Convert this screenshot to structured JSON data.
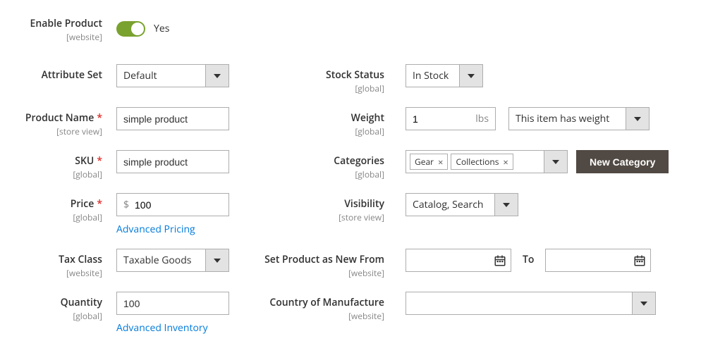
{
  "enable": {
    "label": "Enable Product",
    "scope": "[website]",
    "state_text": "Yes"
  },
  "attribute_set": {
    "label": "Attribute Set",
    "value": "Default"
  },
  "product_name": {
    "label": "Product Name",
    "scope": "[store view]",
    "value": "simple product"
  },
  "sku": {
    "label": "SKU",
    "scope": "[global]",
    "value": "simple product"
  },
  "price": {
    "label": "Price",
    "scope": "[global]",
    "currency": "$",
    "value": "100",
    "adv_link": "Advanced Pricing"
  },
  "tax_class": {
    "label": "Tax Class",
    "scope": "[website]",
    "value": "Taxable Goods"
  },
  "quantity": {
    "label": "Quantity",
    "scope": "[global]",
    "value": "100",
    "adv_link": "Advanced Inventory"
  },
  "stock_status": {
    "label": "Stock Status",
    "scope": "[global]",
    "value": "In Stock"
  },
  "weight": {
    "label": "Weight",
    "scope": "[global]",
    "value": "1",
    "unit": "lbs",
    "type_value": "This item has weight"
  },
  "categories": {
    "label": "Categories",
    "scope": "[global]",
    "tags": [
      "Gear",
      "Collections"
    ],
    "new_btn": "New Category"
  },
  "visibility": {
    "label": "Visibility",
    "scope": "[store view]",
    "value": "Catalog, Search"
  },
  "new_from": {
    "label": "Set Product as New From",
    "scope": "[website]",
    "to_label": "To"
  },
  "country": {
    "label": "Country of Manufacture",
    "scope": "[website]",
    "value": ""
  }
}
